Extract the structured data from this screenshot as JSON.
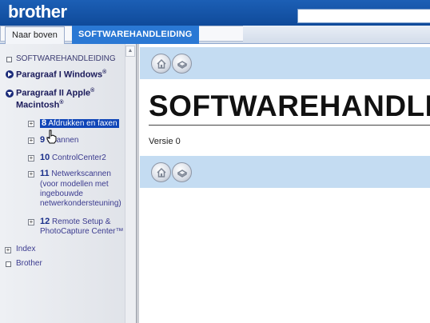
{
  "header": {
    "logo": "brother"
  },
  "tabs": [
    {
      "label": "Naar boven"
    },
    {
      "label": "SOFTWAREHANDLEIDING"
    }
  ],
  "sidebar": {
    "root": "SOFTWAREHANDLEIDING",
    "part1": "Paragraaf I Windows",
    "part1_sup": "®",
    "part2_line1": "Paragraaf II Apple",
    "part2_sup1": "®",
    "part2_line2": "Macintosh",
    "part2_sup2": "®",
    "items": [
      {
        "num": "8",
        "label": "Afdrukken en faxen"
      },
      {
        "num": "9",
        "label": "Scannen"
      },
      {
        "num": "10",
        "label": "ControlCenter2"
      },
      {
        "num": "11",
        "label": "Netwerkscannen",
        "extra": [
          "(voor modellen met",
          "ingebouwde",
          "netwerkondersteuning)"
        ]
      },
      {
        "num": "12",
        "label": "Remote Setup &",
        "extra": [
          "PhotoCapture Center™"
        ]
      }
    ],
    "index": "Index",
    "brother": "Brother"
  },
  "content": {
    "title": "SOFTWAREHANDLEIDING",
    "version": "Versie 0"
  }
}
